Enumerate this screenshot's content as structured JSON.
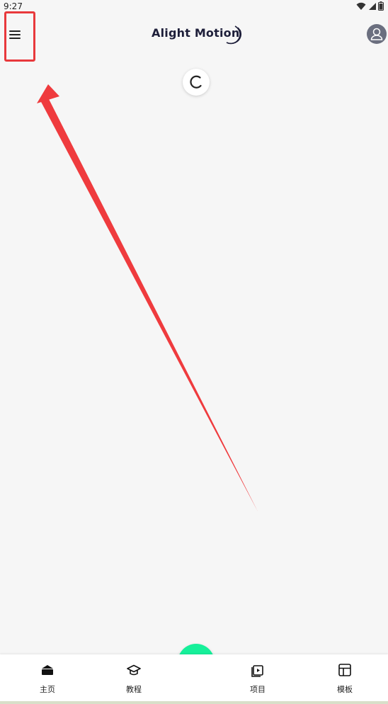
{
  "status_bar": {
    "time": "9:27",
    "icons": [
      "wifi-icon",
      "signal-icon",
      "battery-icon"
    ]
  },
  "header": {
    "menu_icon": "hamburger-menu-icon",
    "logo_text": "Alight Motion",
    "profile_icon": "avatar-icon"
  },
  "content": {
    "loading_icon": "loading-spinner-icon"
  },
  "annotation": {
    "highlight_color": "#e8393c"
  },
  "bottom_nav": {
    "items": [
      {
        "label": "主页",
        "icon": "home-icon"
      },
      {
        "label": "教程",
        "icon": "graduation-cap-icon"
      },
      {
        "label": "项目",
        "icon": "projects-icon"
      },
      {
        "label": "模板",
        "icon": "template-icon"
      }
    ],
    "fab_icon": "plus-icon"
  },
  "colors": {
    "fab": "#16f09a",
    "background": "#f6f6f6",
    "logo": "#1e1f3a"
  }
}
